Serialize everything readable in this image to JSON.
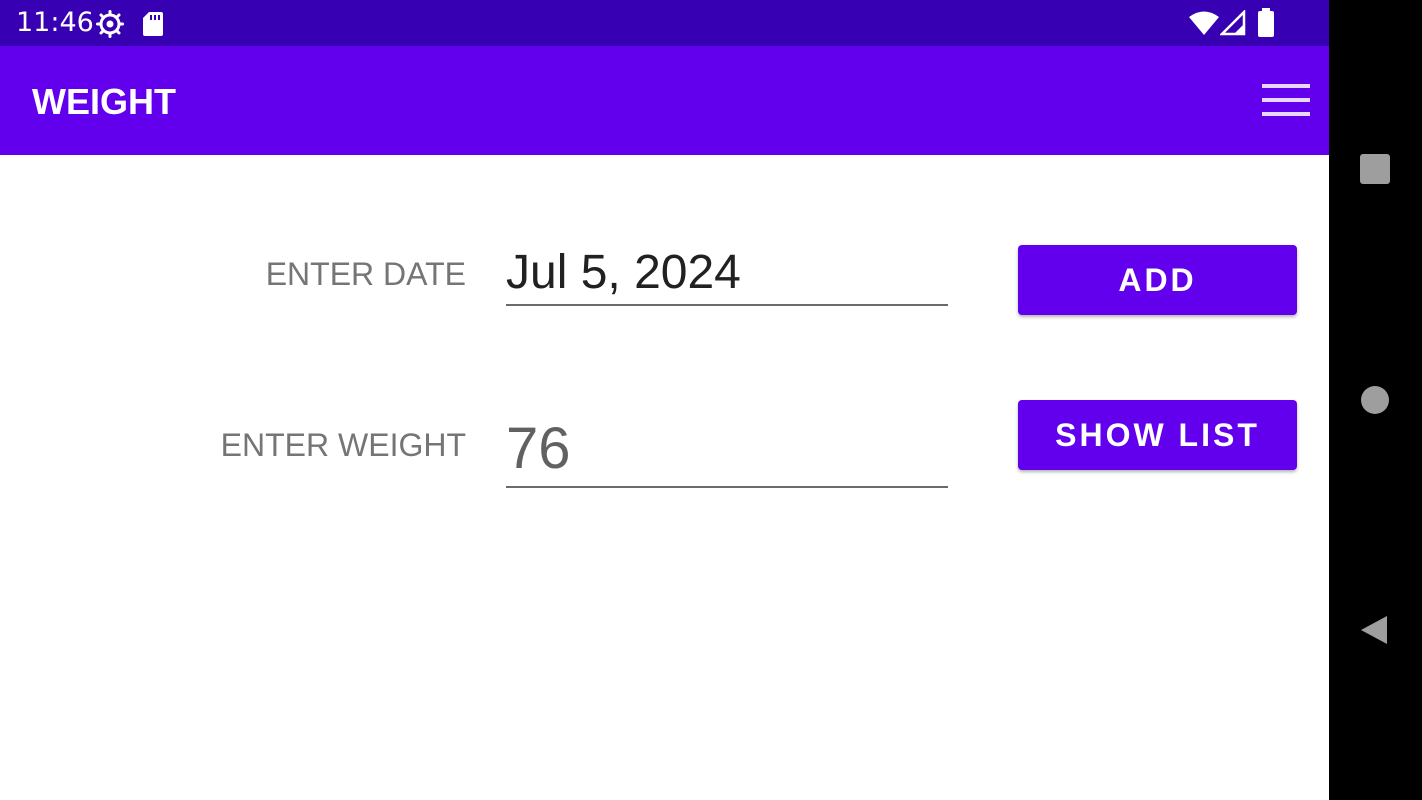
{
  "status_bar": {
    "time": "11:46",
    "icons": [
      "settings-gear-icon",
      "sd-card-icon",
      "wifi-icon",
      "cell-signal-icon",
      "battery-icon"
    ]
  },
  "app_bar": {
    "title": "WEIGHT",
    "menu_icon": "hamburger-menu-icon"
  },
  "form": {
    "date_label": "ENTER DATE",
    "date_value": "Jul 5, 2024",
    "weight_label": "ENTER WEIGHT",
    "weight_value": "76"
  },
  "buttons": {
    "add_label": "ADD",
    "show_list_label": "SHOW LIST"
  },
  "nav_bar": {
    "icons": [
      "recents-icon",
      "home-icon",
      "back-icon"
    ]
  },
  "colors": {
    "status_bar": "#3700b3",
    "app_bar": "#6200ee",
    "button": "#6200ee",
    "nav_bar": "#000000"
  }
}
